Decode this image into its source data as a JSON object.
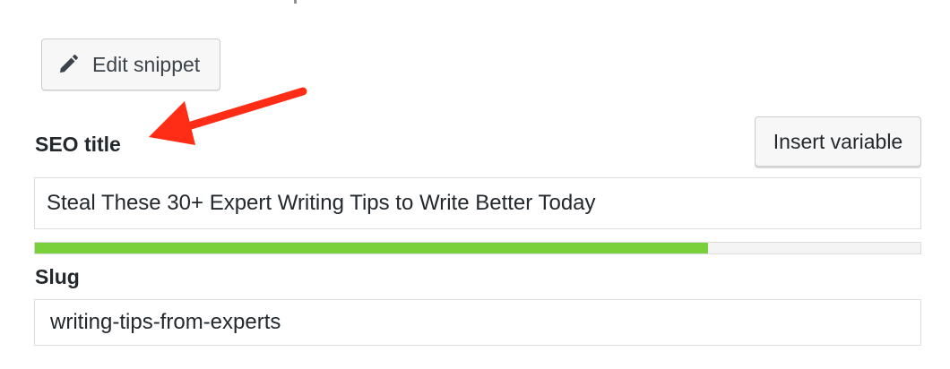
{
  "snippet_editor": {
    "edit_snippet_label": "Edit snippet",
    "edit_icon": "pencil-icon",
    "seo_title_label": "SEO title",
    "insert_variable_label": "Insert variable",
    "seo_title_value": "Steal These 30+ Expert Writing Tips to Write Better Today",
    "title_length_progress_percent": 76,
    "slug_label": "Slug",
    "slug_value": "writing-tips-from-experts"
  },
  "colors": {
    "progress_good": "#7ad03a",
    "annotation_arrow": "#ff2d16"
  }
}
